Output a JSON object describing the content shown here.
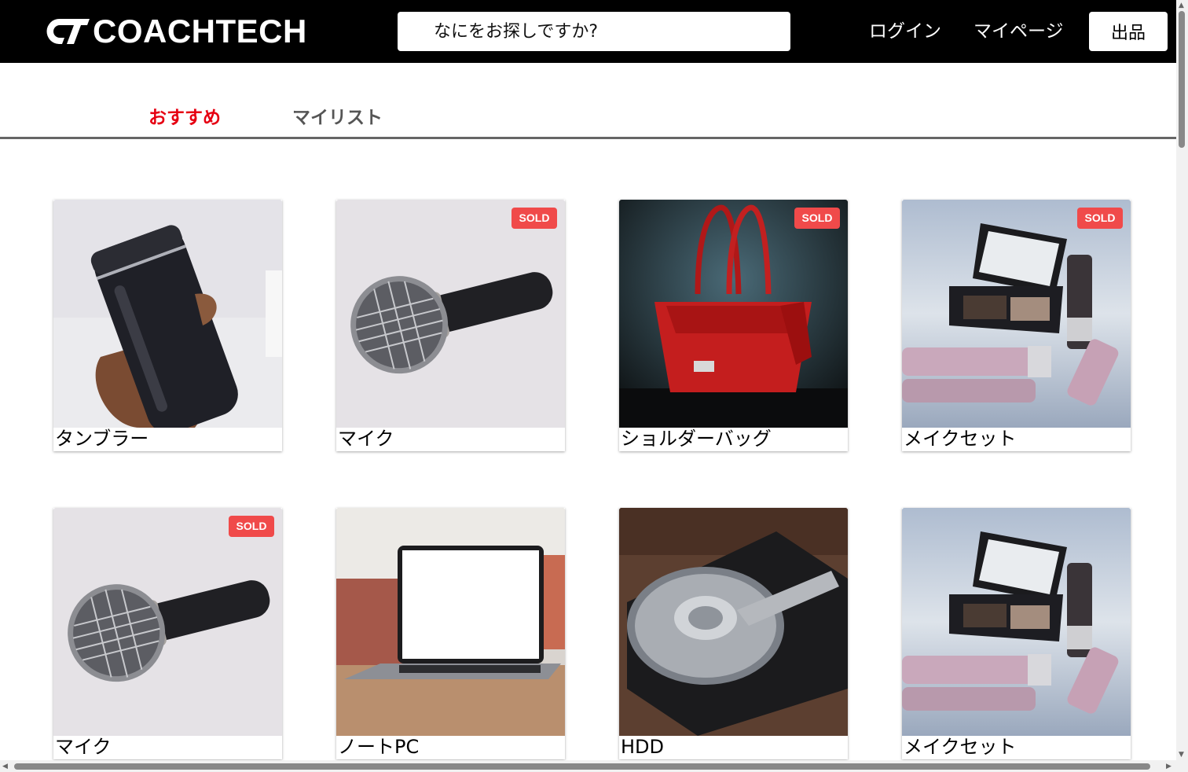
{
  "header": {
    "logo_text": "COACHTECH",
    "logo_mark_text": "CT",
    "search_placeholder": "なにをお探しですか?",
    "nav": {
      "login": "ログイン",
      "mypage": "マイページ"
    },
    "sell_label": "出品"
  },
  "tabs": [
    {
      "label": "おすすめ",
      "active": true
    },
    {
      "label": "マイリスト",
      "active": false
    }
  ],
  "items": [
    {
      "name": "タンブラー",
      "sold": false,
      "image": "tumbler"
    },
    {
      "name": "マイク",
      "sold": true,
      "image": "microphone"
    },
    {
      "name": "ショルダーバッグ",
      "sold": true,
      "image": "red-bag"
    },
    {
      "name": "メイクセット",
      "sold": true,
      "image": "makeup"
    },
    {
      "name": "マイク",
      "sold": true,
      "image": "microphone"
    },
    {
      "name": "ノートPC",
      "sold": false,
      "image": "laptop"
    },
    {
      "name": "HDD",
      "sold": false,
      "image": "hdd"
    },
    {
      "name": "メイクセット",
      "sold": false,
      "image": "makeup"
    }
  ],
  "sold_label": "SOLD",
  "colors": {
    "header_bg": "#000000",
    "active_tab": "#e60012",
    "sold_badge": "#f04a4a"
  }
}
